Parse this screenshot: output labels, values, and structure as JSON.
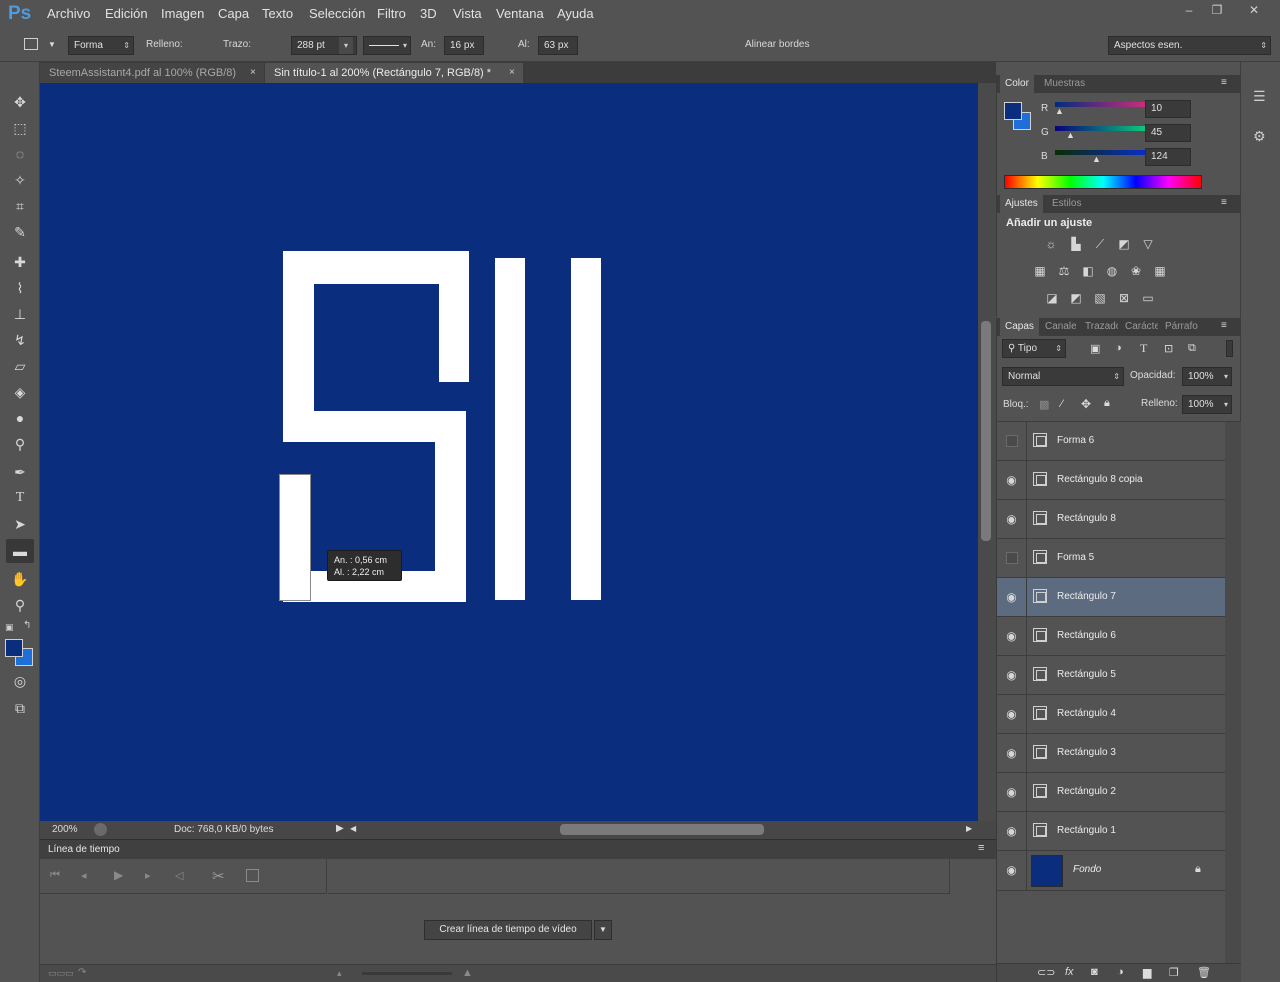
{
  "app": {
    "logo": "Ps"
  },
  "menu": [
    "Archivo",
    "Edición",
    "Imagen",
    "Capa",
    "Texto",
    "Selección",
    "Filtro",
    "3D",
    "Vista",
    "Ventana",
    "Ayuda"
  ],
  "window_controls": [
    "–",
    "❐",
    "✕"
  ],
  "options": {
    "mode": "Forma",
    "fill_label": "Relleno:",
    "fill_color": "#0a2d7d",
    "stroke_label": "Trazo:",
    "stroke_width": "288 pt",
    "width_label": "An:",
    "width_value": "16 px",
    "height_label": "Al:",
    "height_value": "63 px",
    "align_edges": "Alinear bordes",
    "workspace": "Aspectos esen."
  },
  "tabs": [
    {
      "label": "SteemAssistant4.pdf al 100% (RGB/8)",
      "close": "×"
    },
    {
      "label": "Sin título-1 al 200% (Rectángulo 7, RGB/8) *",
      "close": "×"
    }
  ],
  "tooltip": {
    "width": "An. :   0,56 cm",
    "height": "Al. :   2,22 cm"
  },
  "status": {
    "zoom": "200%",
    "doc": "Doc: 768,0 KB/0 bytes"
  },
  "timeline": {
    "title": "Línea de tiempo",
    "create_button": "Crear línea de tiempo de vídeo"
  },
  "color_panel": {
    "tabs": [
      "Color",
      "Muestras"
    ],
    "r_label": "R",
    "r_value": "10",
    "g_label": "G",
    "g_value": "45",
    "b_label": "B",
    "b_value": "124",
    "foreground": "#0a2d7d",
    "background": "#1e6fd9"
  },
  "adjust_panel": {
    "tabs": [
      "Ajustes",
      "Estilos"
    ],
    "heading": "Añadir un ajuste",
    "icons": [
      "brightness-icon",
      "levels-icon",
      "curves-icon",
      "exposure-icon",
      "vibrance-icon",
      "hue-saturation-icon",
      "color-balance-icon",
      "black-white-icon",
      "photo-filter-icon",
      "channel-mixer-icon",
      "color-lookup-icon",
      "invert-icon",
      "posterize-icon",
      "threshold-icon",
      "selective-color-icon",
      "gradient-map-icon"
    ]
  },
  "layers_panel": {
    "tabs": [
      "Capas",
      "Canales",
      "Trazados",
      "Carácter",
      "Párrafo"
    ],
    "filter": "Tipo",
    "blend_mode": "Normal",
    "opacity_label": "Opacidad:",
    "opacity_value": "100%",
    "lock_label": "Bloq.:",
    "fill_label": "Relleno:",
    "fill_value": "100%",
    "layers": [
      {
        "name": "Forma 6",
        "visible": false,
        "selected": false
      },
      {
        "name": "Rectángulo 8 copia",
        "visible": true,
        "selected": false
      },
      {
        "name": "Rectángulo 8",
        "visible": true,
        "selected": false
      },
      {
        "name": "Forma 5",
        "visible": false,
        "selected": false
      },
      {
        "name": "Rectángulo 7",
        "visible": true,
        "selected": true
      },
      {
        "name": "Rectángulo 6",
        "visible": true,
        "selected": false
      },
      {
        "name": "Rectángulo 5",
        "visible": true,
        "selected": false
      },
      {
        "name": "Rectángulo 4",
        "visible": true,
        "selected": false
      },
      {
        "name": "Rectángulo 3",
        "visible": true,
        "selected": false
      },
      {
        "name": "Rectángulo 2",
        "visible": true,
        "selected": false
      },
      {
        "name": "Rectángulo 1",
        "visible": true,
        "selected": false
      },
      {
        "name": "Fondo",
        "visible": true,
        "selected": false,
        "locked": true
      }
    ]
  }
}
